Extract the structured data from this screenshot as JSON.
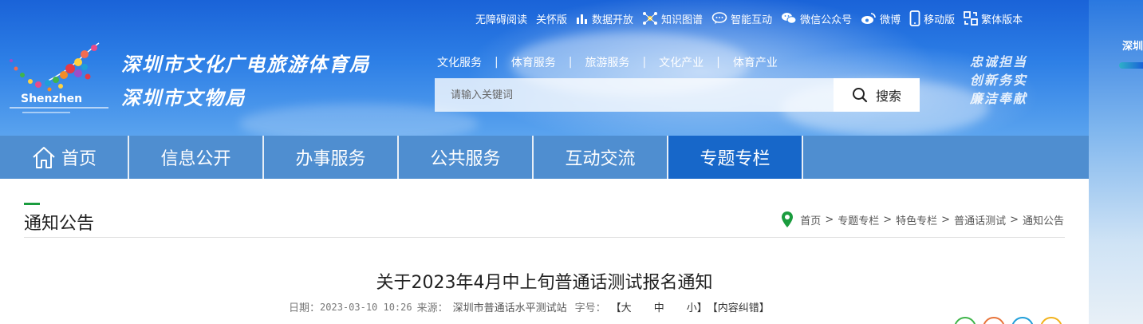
{
  "top_links": [
    {
      "label": "无障碍阅读",
      "icon": ""
    },
    {
      "label": "关怀版",
      "icon": ""
    },
    {
      "label": "数据开放",
      "icon": "bar-chart-icon"
    },
    {
      "label": "知识图谱",
      "icon": "knowledge-graph-icon"
    },
    {
      "label": "智能互动",
      "icon": "chat-bubble-icon"
    },
    {
      "label": "微信公众号",
      "icon": "wechat-icon"
    },
    {
      "label": "微博",
      "icon": "weibo-icon"
    },
    {
      "label": "移动版",
      "icon": "mobile-icon"
    },
    {
      "label": "繁体版本",
      "icon": "traditional-chinese-icon"
    }
  ],
  "logo": {
    "name": "Shenzhen",
    "org_line1": "深圳市文化广电旅游体育局",
    "org_line2": "深圳市文物局"
  },
  "service_links": [
    "文化服务",
    "体育服务",
    "旅游服务",
    "文化产业",
    "体育产业"
  ],
  "service_sep": "|",
  "search": {
    "placeholder": "请输入关键词",
    "button_label": "搜索"
  },
  "slogan": [
    "忠诚担当",
    "创新务实",
    "廉洁奉献"
  ],
  "side_text": "深圳",
  "nav": [
    {
      "label": "首页",
      "active": false
    },
    {
      "label": "信息公开",
      "active": false
    },
    {
      "label": "办事服务",
      "active": false
    },
    {
      "label": "公共服务",
      "active": false
    },
    {
      "label": "互动交流",
      "active": false
    },
    {
      "label": "专题专栏",
      "active": true
    }
  ],
  "section_title": "通知公告",
  "breadcrumb": [
    "首页",
    "专题专栏",
    "特色专栏",
    "普通话测试",
    "通知公告"
  ],
  "breadcrumb_sep": ">",
  "article": {
    "title": "关于2023年4月中上旬普通话测试报名通知",
    "date_label": "日期：",
    "date": "2023-03-10 10:26",
    "source_label": "来源：",
    "source": "深圳市普通话水平测试站",
    "fontsize_label": "字号：",
    "fontsize_open": "【",
    "fontsize_options": [
      "大",
      "中",
      "小"
    ],
    "fontsize_close": "】",
    "error_report": "【内容纠错】"
  },
  "colors": {
    "nav_bg": "#4f8ed0",
    "nav_active": "#1767c9",
    "accent_green": "#1a9c3e",
    "header_blue": "#1a63d8"
  }
}
